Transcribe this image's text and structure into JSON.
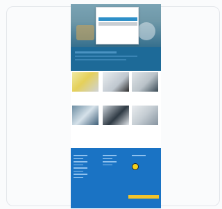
{
  "modal": {
    "title": "",
    "text": "",
    "accept_label": "",
    "settings_label": "",
    "link_label": ""
  },
  "tiles": [
    {
      "caption": ""
    },
    {
      "caption": ""
    },
    {
      "caption": ""
    },
    {
      "caption": ""
    },
    {
      "caption": ""
    },
    {
      "caption": ""
    }
  ],
  "footer": {
    "col1_title": "",
    "col2_title": "",
    "col3_title": "",
    "cta_label": ""
  },
  "colors": {
    "brand_blue": "#1a73c4",
    "accent_yellow": "#f2c32a"
  }
}
